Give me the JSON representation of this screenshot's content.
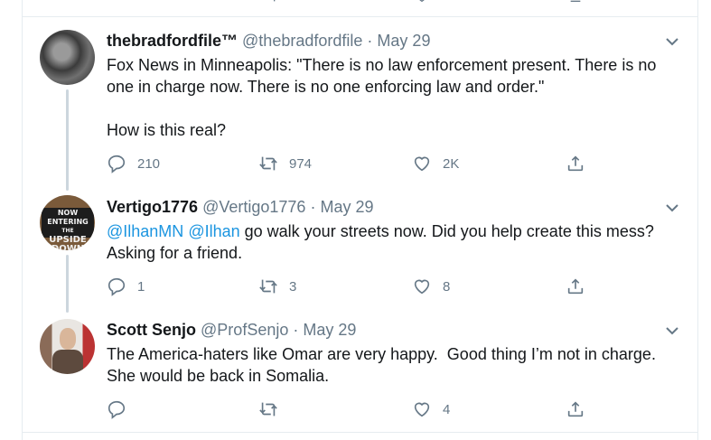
{
  "tweets": [
    {
      "name": "thebradfordfile™",
      "handle": "@thebradfordfile",
      "date": "May 29",
      "text": "Fox News in Minneapolis: \"There is no law enforcement present. There is no\none in charge now. There is no one enforcing law and order.\"\n\nHow is this real?",
      "replies": "210",
      "retweets": "974",
      "likes": "2K"
    },
    {
      "name": "Vertigo1776",
      "handle": "@Vertigo1776",
      "date": "May 29",
      "mention1": "@IlhanMN",
      "mention2": "@Ilhan",
      "text_line1": " go walk your streets now. Did you help create this mess?",
      "text_line2": "Asking for a friend.",
      "avatar_text": [
        "NOW ENTERING",
        "THE",
        "UPSIDE DOWN"
      ],
      "replies": "1",
      "retweets": "3",
      "likes": "8"
    },
    {
      "name": "Scott Senjo",
      "handle": "@ProfSenjo",
      "date": "May 29",
      "text": "The America-haters like Omar are very happy.  Good thing I’m not in charge.\nShe would be back in Somalia.",
      "replies": "",
      "retweets": "",
      "likes": "4"
    }
  ],
  "separator": "·",
  "icons": {
    "reply": "reply-icon",
    "retweet": "retweet-icon",
    "like": "heart-icon",
    "share": "share-icon",
    "more": "chevron-down-icon"
  },
  "colors": {
    "text": "#14171a",
    "muted": "#657786",
    "link": "#1b95e0",
    "thread": "#ccd6dd",
    "border": "#e6ecf0"
  }
}
